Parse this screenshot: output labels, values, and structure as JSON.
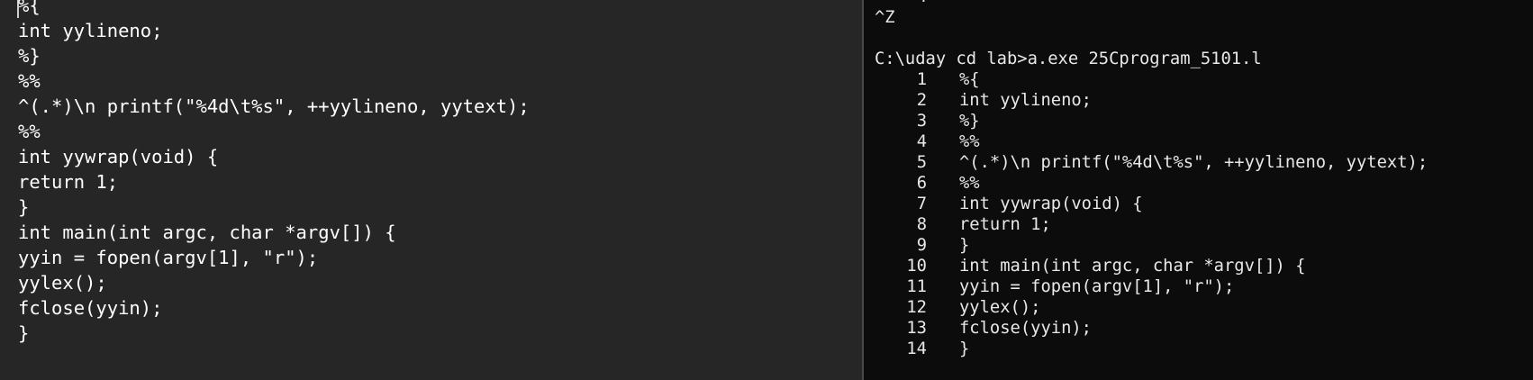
{
  "editor": {
    "lines": [
      "%{",
      "int yylineno;",
      "%}",
      "%%",
      "^(.*)\\n printf(\"%4d\\t%s\", ++yylineno, yytext);",
      "%%",
      "int yywrap(void) {",
      "return 1;",
      "}",
      "int main(int argc, char *argv[]) {",
      "yyin = fopen(argv[1], \"r\");",
      "yylex();",
      "fclose(yyin);",
      "}"
    ]
  },
  "terminal": {
    "cut_off_number": "4",
    "eof_marker": "^Z",
    "command": "C:\\uday cd lab>a.exe 25Cprogram_5101.l",
    "output": [
      {
        "n": "1",
        "text": "%{"
      },
      {
        "n": "2",
        "text": "int yylineno;"
      },
      {
        "n": "3",
        "text": "%}"
      },
      {
        "n": "4",
        "text": "%%"
      },
      {
        "n": "5",
        "text": "^(.*)\\n printf(\"%4d\\t%s\", ++yylineno, yytext);"
      },
      {
        "n": "6",
        "text": "%%"
      },
      {
        "n": "7",
        "text": "int yywrap(void) {"
      },
      {
        "n": "8",
        "text": "return 1;"
      },
      {
        "n": "9",
        "text": "}"
      },
      {
        "n": "10",
        "text": "int main(int argc, char *argv[]) {"
      },
      {
        "n": "11",
        "text": "yyin = fopen(argv[1], \"r\");"
      },
      {
        "n": "12",
        "text": "yylex();"
      },
      {
        "n": "13",
        "text": "fclose(yyin);"
      },
      {
        "n": "14",
        "text": "}"
      }
    ]
  }
}
